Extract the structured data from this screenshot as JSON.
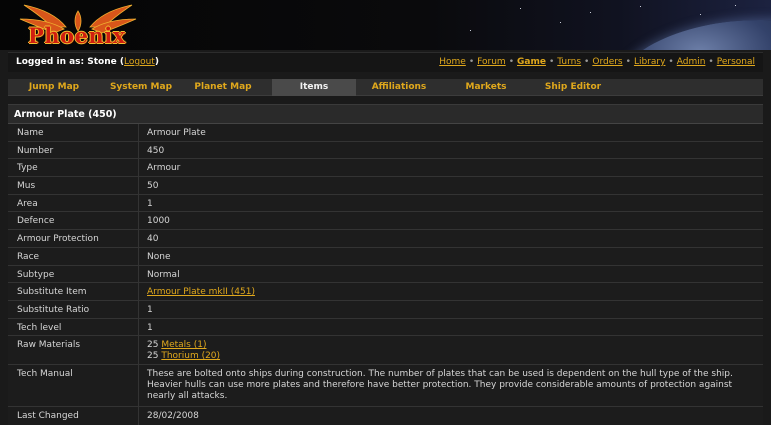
{
  "logo": {
    "text": "Phoenix"
  },
  "login": {
    "prefix": "Logged in as: Stone (",
    "logout_label": "Logout",
    "suffix": ")"
  },
  "toplinks": [
    "Home",
    "Forum",
    "Game",
    "Turns",
    "Orders",
    "Library",
    "Admin",
    "Personal"
  ],
  "active_toplink": "Game",
  "tabs": [
    "Jump Map",
    "System Map",
    "Planet Map",
    "Items",
    "Affiliations",
    "Markets",
    "Ship Editor"
  ],
  "active_tab": "Items",
  "item": {
    "title": "Armour Plate (450)",
    "rows": {
      "name": {
        "label": "Name",
        "value": "Armour Plate"
      },
      "number": {
        "label": "Number",
        "value": "450"
      },
      "type": {
        "label": "Type",
        "value": "Armour"
      },
      "mus": {
        "label": "Mus",
        "value": "50"
      },
      "area": {
        "label": "Area",
        "value": "1"
      },
      "defence": {
        "label": "Defence",
        "value": "1000"
      },
      "armour_protection": {
        "label": "Armour Protection",
        "value": "40"
      },
      "race": {
        "label": "Race",
        "value": "None"
      },
      "subtype": {
        "label": "Subtype",
        "value": "Normal"
      },
      "substitute_item": {
        "label": "Substitute Item",
        "value": "Armour Plate mkII (451)"
      },
      "substitute_ratio": {
        "label": "Substitute Ratio",
        "value": "1"
      },
      "tech_level": {
        "label": "Tech level",
        "value": "1"
      },
      "raw_materials": {
        "label": "Raw Materials",
        "items": [
          {
            "qty": "25",
            "name": "Metals (1)"
          },
          {
            "qty": "25",
            "name": "Thorium (20)"
          }
        ]
      },
      "tech_manual": {
        "label": "Tech Manual",
        "value": "These are bolted onto ships during construction. The number of plates that can be used is dependent on the hull type of the ship. Heavier hulls can use more plates and therefore have better protection. They provide considerable amounts of protection against nearly all attacks."
      },
      "last_changed": {
        "label": "Last Changed",
        "value": "28/02/2008"
      }
    }
  },
  "colors": {
    "link": "#e0a81c",
    "background": "#1a1a1a",
    "logo_red": "#d01e10"
  }
}
